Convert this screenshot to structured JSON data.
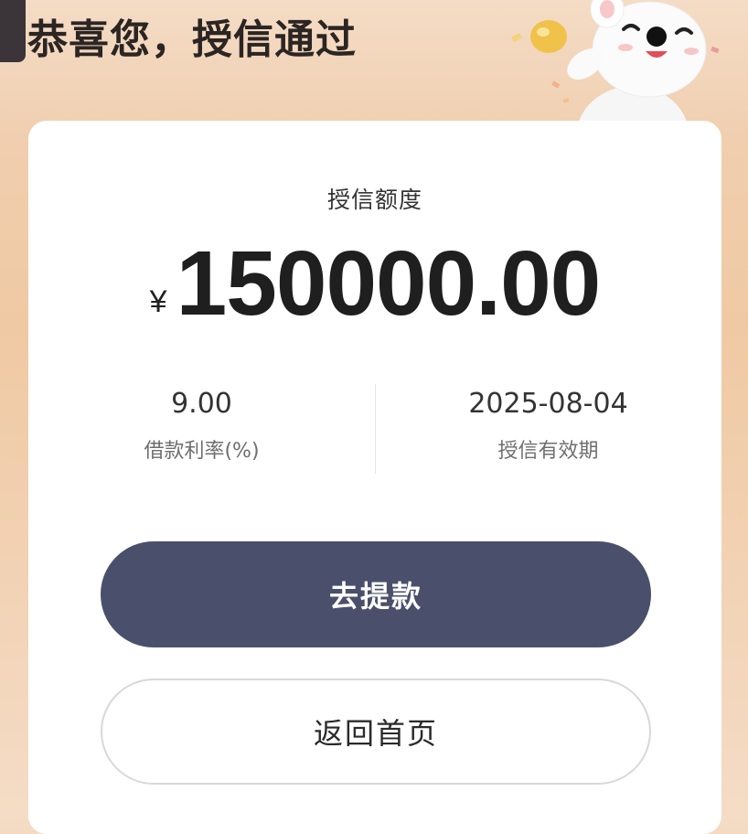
{
  "header": {
    "title": "恭喜您，授信通过",
    "mascot_icon": "rabbit-mascot-icon"
  },
  "credit": {
    "label": "授信额度",
    "currency_symbol": "¥",
    "amount": "150000.00"
  },
  "details": {
    "rate_value": "9.00",
    "rate_label": "借款利率(%)",
    "expiry_value": "2025-08-04",
    "expiry_label": "授信有效期"
  },
  "actions": {
    "withdraw_label": "去提款",
    "home_label": "返回首页"
  },
  "colors": {
    "primary_button": "#4a4f6b",
    "background_peach": "#efc9a3"
  }
}
